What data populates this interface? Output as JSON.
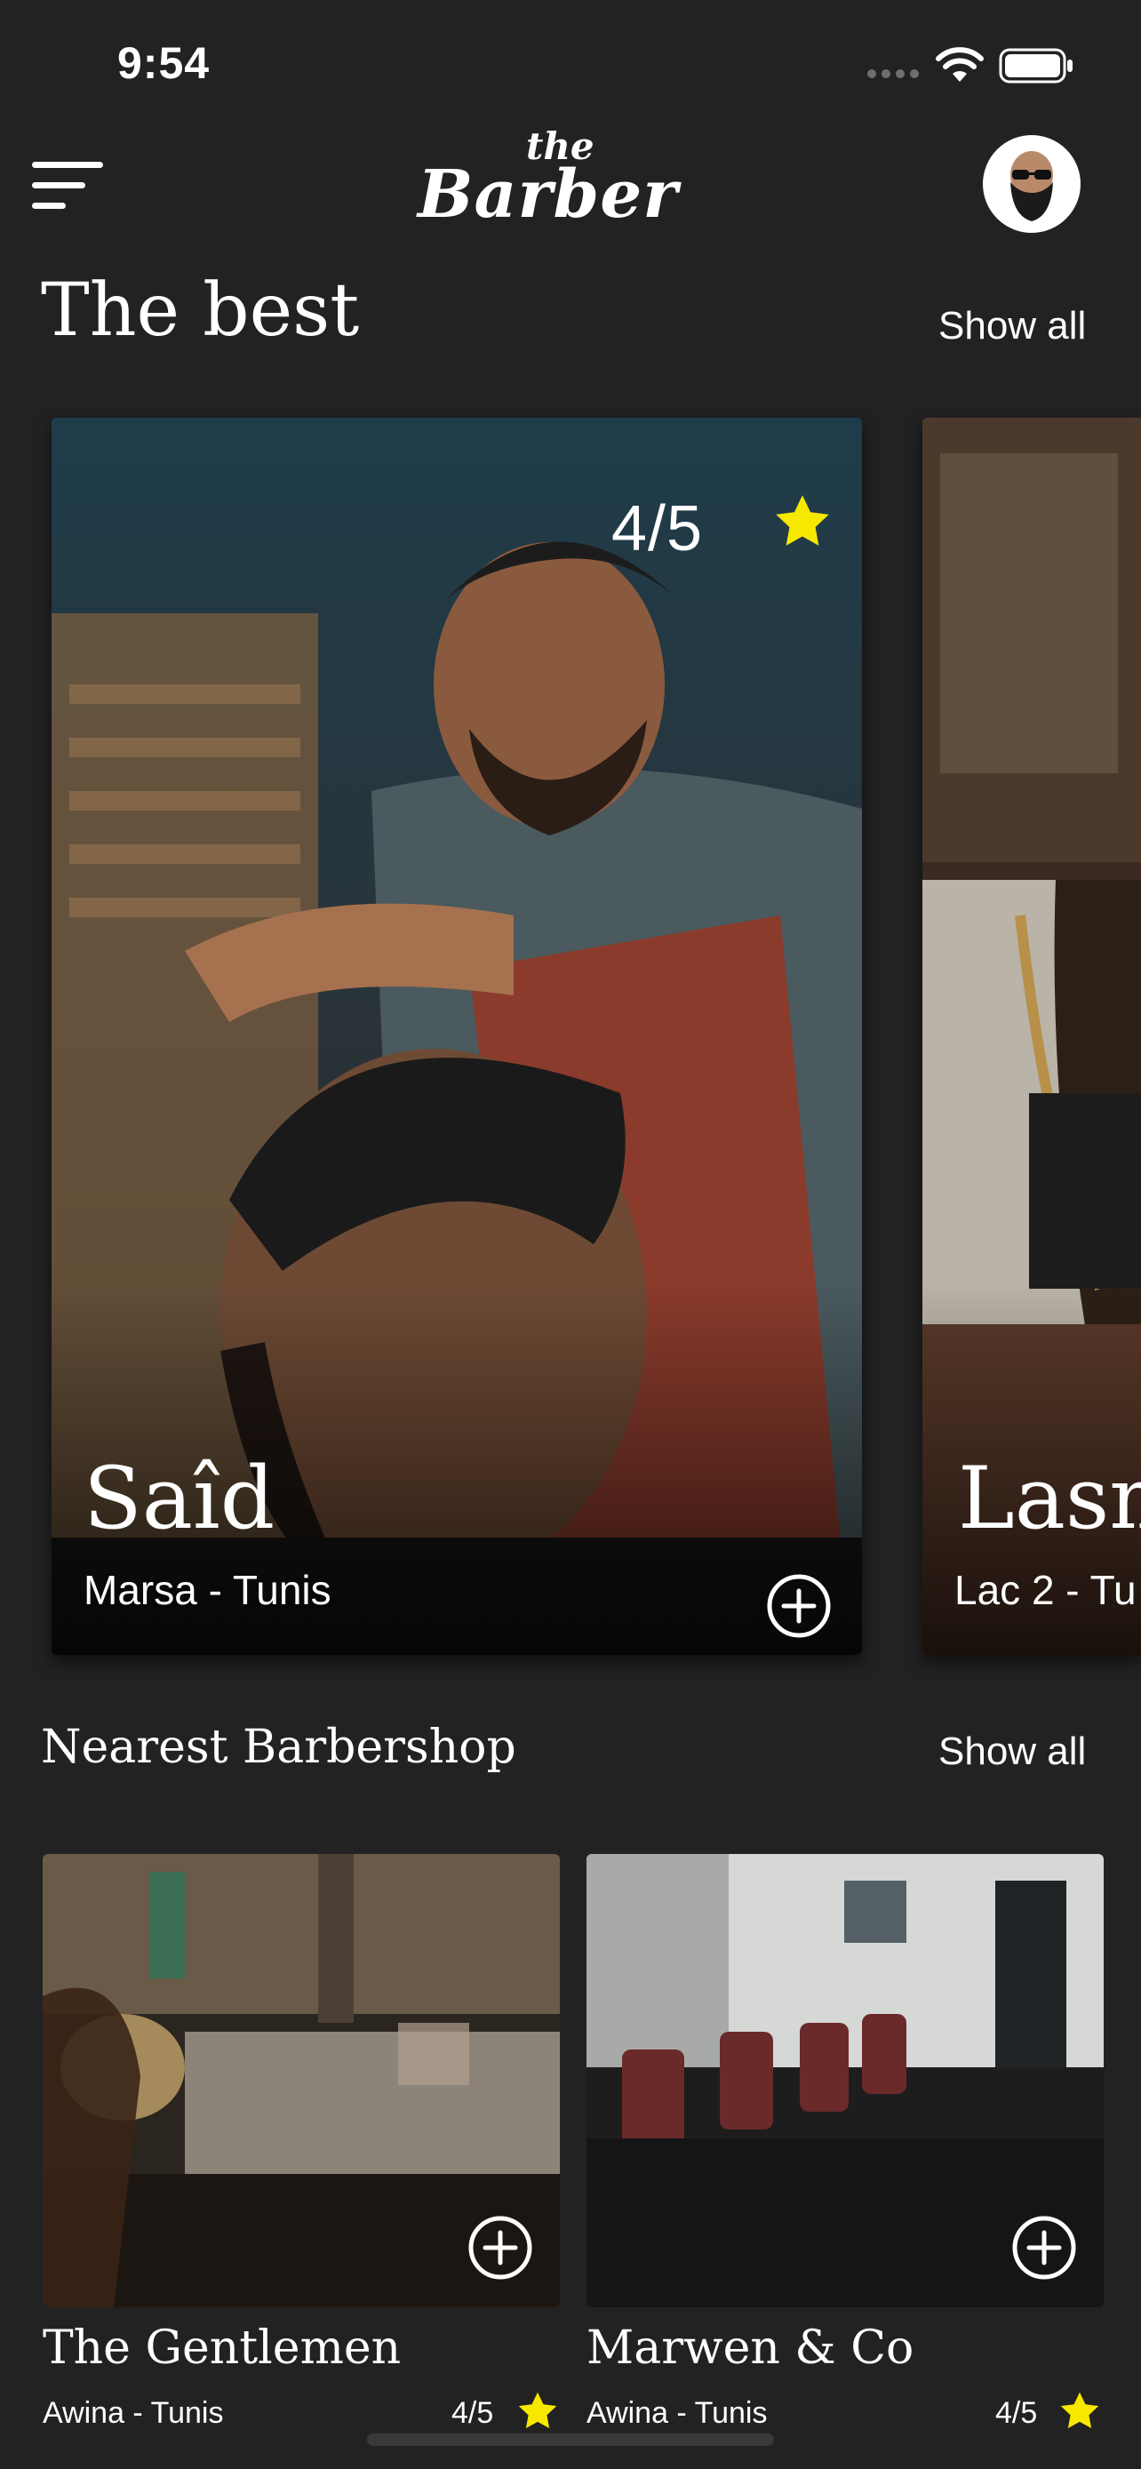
{
  "status_bar": {
    "time": "9:54"
  },
  "header": {
    "logo_small": "the",
    "logo_main": "Barber"
  },
  "best_section": {
    "title": "The best",
    "show_all": "Show all",
    "cards": [
      {
        "name": "Saîd",
        "location": "Marsa - Tunis",
        "rating": "4/5"
      },
      {
        "name": "Lasm",
        "location": "Lac 2 - Tu"
      }
    ]
  },
  "nearest_section": {
    "title": "Nearest Barbershop",
    "show_all": "Show all",
    "shops": [
      {
        "name": "The Gentlemen",
        "location": "Awina - Tunis",
        "rating": "4/5"
      },
      {
        "name": "Marwen & Co",
        "location": "Awina - Tunis",
        "rating": "4/5"
      }
    ]
  },
  "colors": {
    "background": "#232223",
    "star": "#f7e800",
    "text": "#ffffff"
  },
  "icons": [
    "menu-icon",
    "wifi-icon",
    "battery-icon",
    "star-icon",
    "add-circle-icon"
  ]
}
